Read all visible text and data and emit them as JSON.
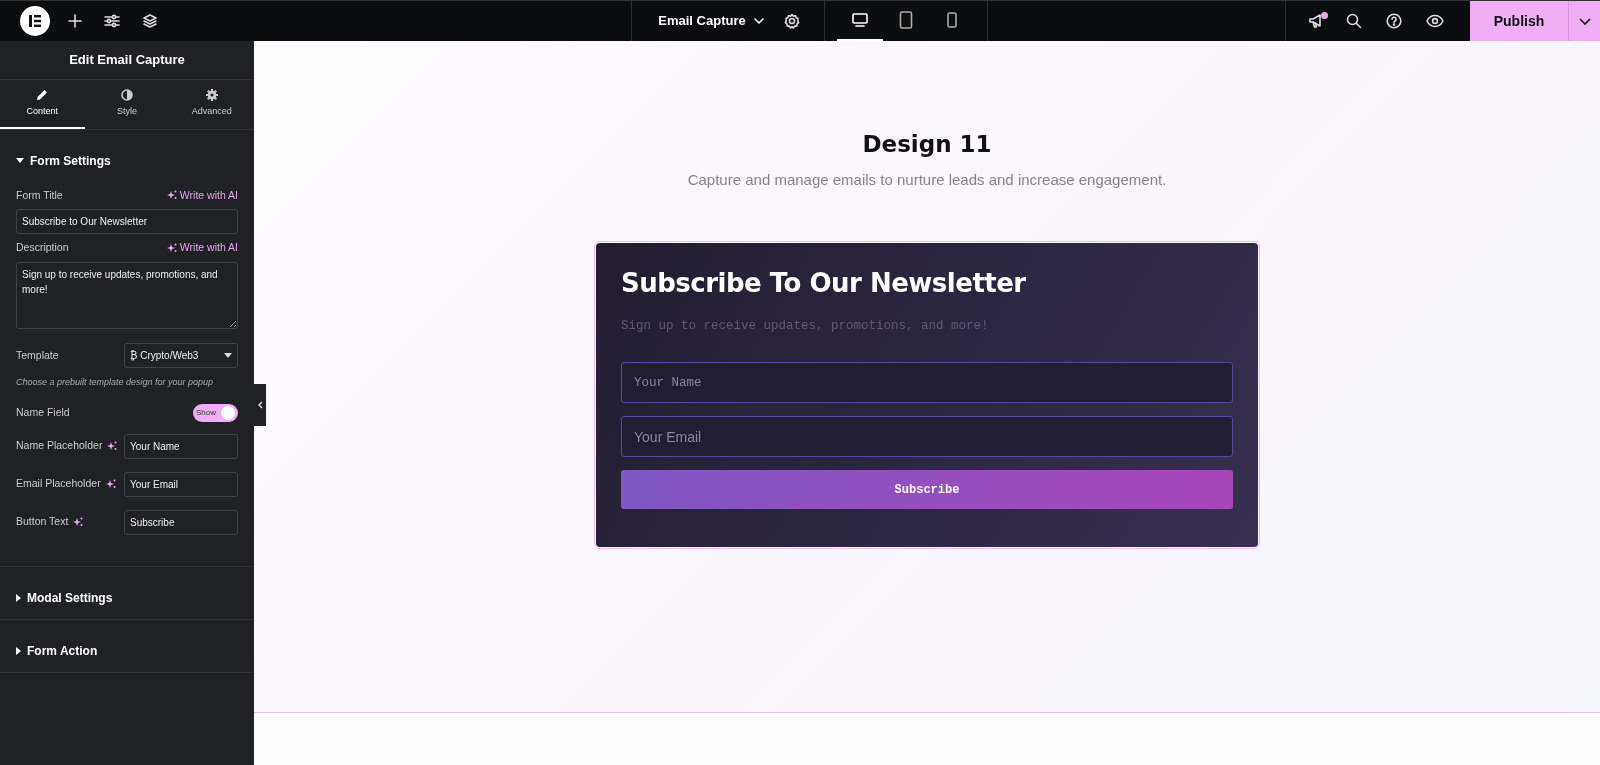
{
  "topbar": {
    "document_title": "Email Capture",
    "devices": [
      {
        "kind": "desktop",
        "selected": true
      },
      {
        "kind": "tablet",
        "selected": false
      },
      {
        "kind": "mobile",
        "selected": false
      }
    ],
    "notifications_unread": true,
    "publish_label": "Publish"
  },
  "panel": {
    "title": "Edit Email Capture",
    "tabs": [
      {
        "kind": "content",
        "label": "Content",
        "selected": true
      },
      {
        "kind": "style",
        "label": "Style",
        "selected": false
      },
      {
        "kind": "advanced",
        "label": "Advanced",
        "selected": false
      }
    ],
    "sections": [
      {
        "title": "Form Settings",
        "expanded": true,
        "fields": [
          {
            "kind": "text",
            "label": "Form Title",
            "ai_link": "Write with AI",
            "value": "Subscribe to Our Newsletter"
          },
          {
            "kind": "textarea",
            "label": "Description",
            "ai_link": "Write with AI",
            "value": "Sign up to receive updates, promotions, and more!"
          },
          {
            "kind": "select",
            "label": "Template",
            "value": "₿ Crypto/Web3",
            "help": "Choose a prebuilt template design for your popup"
          },
          {
            "kind": "toggle",
            "label": "Name Field",
            "on": true,
            "state_label": "Show"
          },
          {
            "kind": "inline",
            "label": "Name Placeholder",
            "value": "Your Name"
          },
          {
            "kind": "inline",
            "label": "Email Placeholder",
            "value": "Your Email"
          },
          {
            "kind": "inline",
            "label": "Button Text",
            "value": "Subscribe"
          }
        ]
      },
      {
        "title": "Modal Settings",
        "expanded": false
      },
      {
        "title": "Form Action",
        "expanded": false
      }
    ]
  },
  "canvas": {
    "heading": "Design 11",
    "subheading": "Capture and manage emails to nurture leads and increase engagement.",
    "card": {
      "title": "Subscribe To Our Newsletter",
      "description": "Sign up to receive updates, promotions, and more!",
      "name_placeholder": "Your Name",
      "email_placeholder": "Your Email",
      "button": "Subscribe"
    }
  }
}
